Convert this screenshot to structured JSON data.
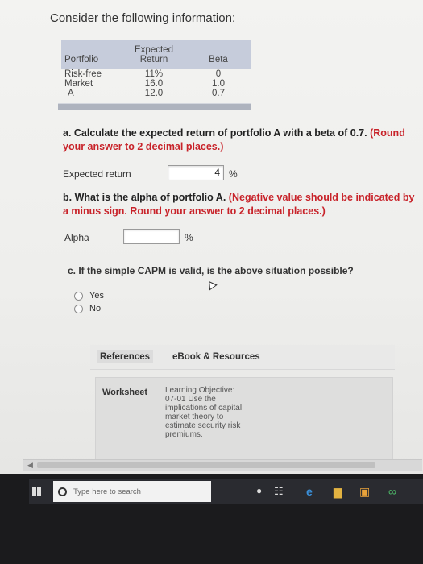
{
  "heading": "Consider the following information:",
  "table": {
    "col_portfolio": "Portfolio",
    "col_expected_line1": "Expected",
    "col_expected_line2": "Return",
    "col_beta": "Beta",
    "rows": [
      {
        "name": "Risk-free",
        "ret": "11%",
        "beta": "0"
      },
      {
        "name": "Market",
        "ret": "16.0",
        "beta": "1.0"
      },
      {
        "name": "A",
        "ret": "12.0",
        "beta": "0.7"
      }
    ]
  },
  "q_a": {
    "text": "a. Calculate the expected return of portfolio A with a beta of 0.7.",
    "note": "(Round your answer to 2 decimal places.)",
    "label": "Expected return",
    "value": "4",
    "unit": "%"
  },
  "q_b": {
    "text": "b. What is the alpha of portfolio A.",
    "note": "(Negative value should be indicated by a minus sign. Round your answer to 2 decimal places.)",
    "label": "Alpha",
    "value": "",
    "unit": "%"
  },
  "q_c": {
    "text": "c. If the simple CAPM is valid, is the above situation possible?",
    "options": [
      "Yes",
      "No"
    ]
  },
  "tabs": {
    "references": "References",
    "ebook": "eBook & Resources"
  },
  "panel": {
    "key": "Worksheet",
    "value": "Learning Objective: 07-01 Use the implications of capital market theory to estimate security risk premiums."
  },
  "taskbar": {
    "search_placeholder": "Type here to search"
  }
}
